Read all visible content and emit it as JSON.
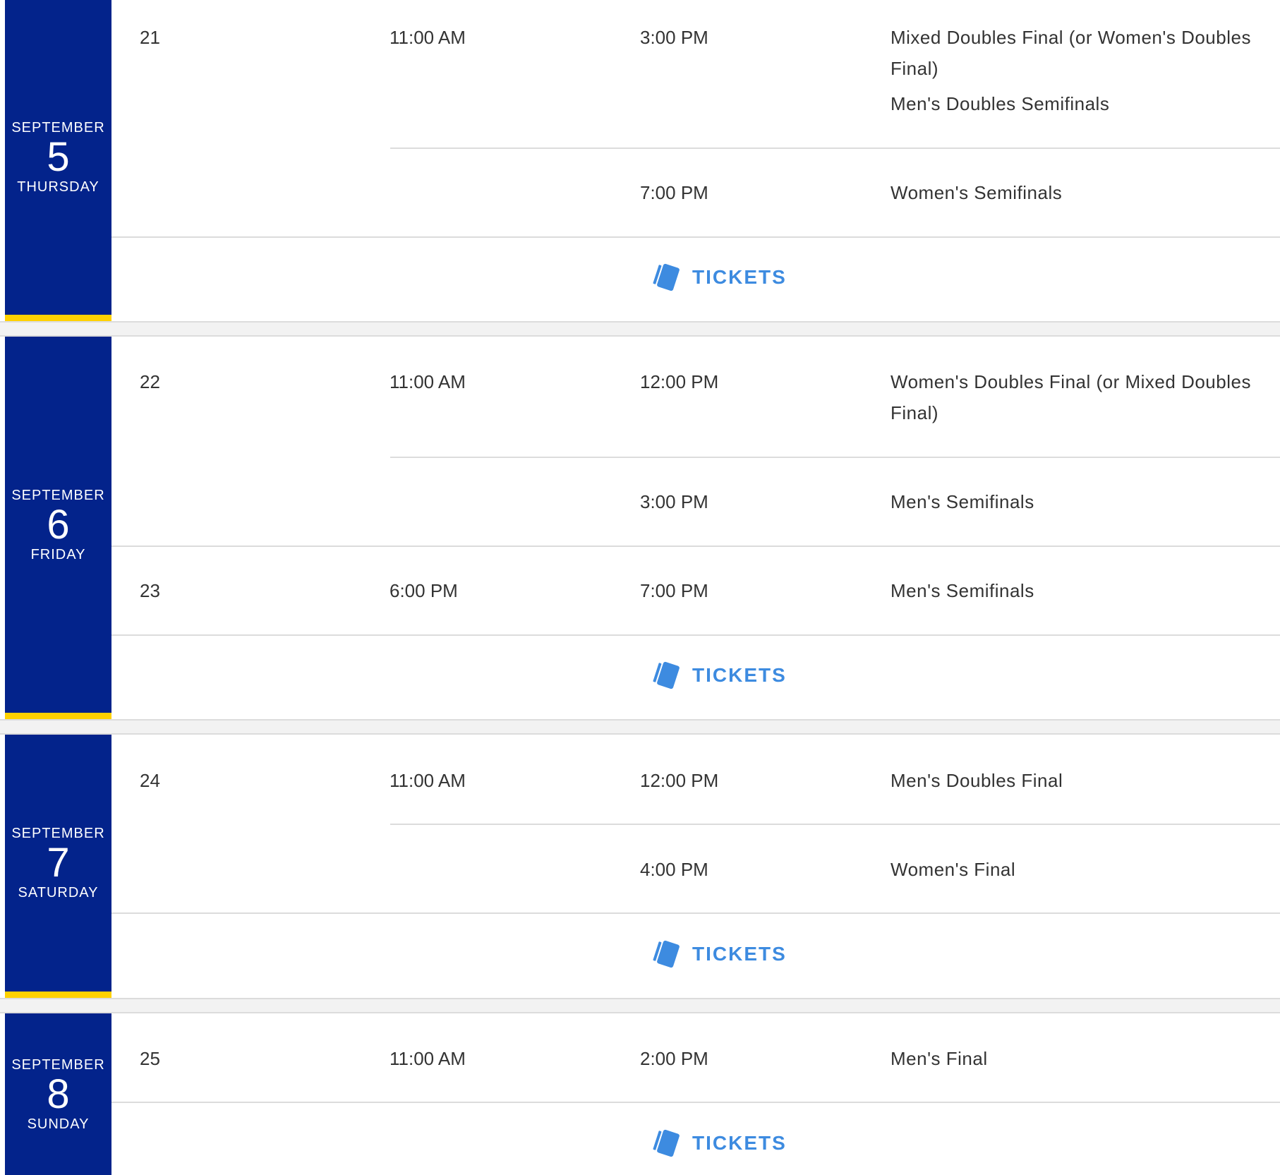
{
  "days": [
    {
      "month": "SEPTEMBER",
      "date": "5",
      "weekday": "THURSDAY",
      "sessions": [
        {
          "session": "21",
          "gates": "11:00 AM",
          "matches": [
            {
              "time": "3:00 PM",
              "events": [
                "Mixed Doubles Final (or Women's Doubles Final)",
                "Men's Doubles Semifinals"
              ]
            },
            {
              "time": "7:00 PM",
              "events": [
                "Women's Semifinals"
              ]
            }
          ]
        }
      ],
      "tickets_label": "TICKETS"
    },
    {
      "month": "SEPTEMBER",
      "date": "6",
      "weekday": "FRIDAY",
      "sessions": [
        {
          "session": "22",
          "gates": "11:00 AM",
          "matches": [
            {
              "time": "12:00 PM",
              "events": [
                "Women's Doubles Final (or Mixed Doubles Final)"
              ]
            },
            {
              "time": "3:00 PM",
              "events": [
                "Men's Semifinals"
              ]
            }
          ]
        },
        {
          "session": "23",
          "gates": "6:00 PM",
          "matches": [
            {
              "time": "7:00 PM",
              "events": [
                "Men's Semifinals"
              ]
            }
          ]
        }
      ],
      "tickets_label": "TICKETS"
    },
    {
      "month": "SEPTEMBER",
      "date": "7",
      "weekday": "SATURDAY",
      "sessions": [
        {
          "session": "24",
          "gates": "11:00 AM",
          "matches": [
            {
              "time": "12:00 PM",
              "events": [
                "Men's Doubles Final"
              ]
            },
            {
              "time": "4:00 PM",
              "events": [
                "Women's Final"
              ]
            }
          ]
        }
      ],
      "tickets_label": "TICKETS"
    },
    {
      "month": "SEPTEMBER",
      "date": "8",
      "weekday": "SUNDAY",
      "sessions": [
        {
          "session": "25",
          "gates": "11:00 AM",
          "matches": [
            {
              "time": "2:00 PM",
              "events": [
                "Men's Final"
              ]
            }
          ]
        }
      ],
      "tickets_label": "TICKETS"
    }
  ],
  "colors": {
    "date_panel": "#03238b",
    "accent_bar": "#ffd100",
    "tickets_link": "#3d8be0",
    "divider": "#dcdcdc",
    "gap_band": "#f2f2f2"
  },
  "icons": {
    "tickets": "ticket-icon"
  }
}
